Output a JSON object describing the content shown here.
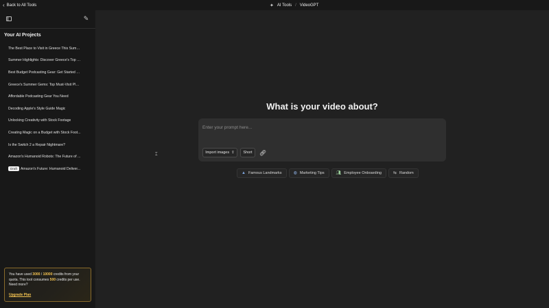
{
  "topbar": {
    "back_label": "Back to All Tools",
    "breadcrumbs": [
      "AI Tools",
      "VideoGPT"
    ],
    "separator": "/"
  },
  "sidebar": {
    "title": "Your AI Projects",
    "projects": [
      {
        "label": "The Best Place to Visit in Greece This Summer"
      },
      {
        "label": "Summer Highlights: Discover Greece's Top D..."
      },
      {
        "label": "Best Budget Podcasting Gear: Get Started T..."
      },
      {
        "label": "Greece's Summer Gems: Top Must-Visit Plac..."
      },
      {
        "label": "Affordable Podcasting Gear You Need"
      },
      {
        "label": "Decoding Apple's Style Guide Magic"
      },
      {
        "label": "Unlocking Creativity with Stock Footage"
      },
      {
        "label": "Creating Magic on a Budget with Stock Foot..."
      },
      {
        "label": "Is the Switch 2 a Repair Nightmare?"
      },
      {
        "label": "Amazon's Humanoid Robots: The Future of ..."
      },
      {
        "label": "Amazon's Future: Humanoid Deliver...",
        "badge": "Draft"
      }
    ],
    "credits": {
      "prefix": "You have used ",
      "used": "3000",
      "slash": " / ",
      "total": "10000",
      "mid": " credits from your quota. This tool consumes ",
      "per_use": "500",
      "suffix": " credits per use. Need more?",
      "upgrade_label": "Upgrade Plan"
    }
  },
  "main": {
    "title": "What is your video about?",
    "prompt": {
      "placeholder": "Enter your prompt here...",
      "value": ""
    },
    "buttons": {
      "import_label": "Import images",
      "short_label": "Short"
    },
    "suggestions": [
      {
        "label": "Famous Landmarks",
        "icon": "landscape-icon"
      },
      {
        "label": "Marketing Tips",
        "icon": "globe-icon"
      },
      {
        "label": "Employee Onboarding",
        "icon": "users-icon"
      },
      {
        "label": "Random",
        "icon": "shuffle-icon"
      }
    ]
  },
  "colors": {
    "background": "#212121",
    "sidebar": "#181818",
    "accent": "#f5c451"
  }
}
